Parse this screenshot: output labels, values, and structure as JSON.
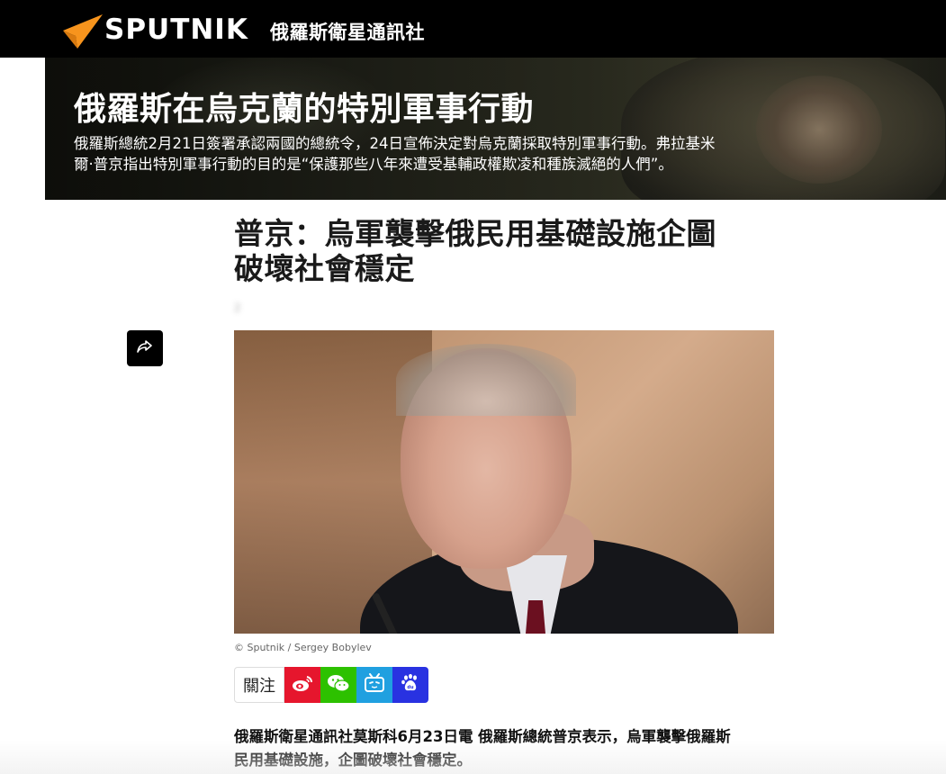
{
  "header": {
    "logo_text": "SPUTNIK",
    "logo_icon": "sputnik-wing-icon",
    "agency_name": "俄羅斯衛星通訊社",
    "background_color": "#000000",
    "accent_color": "#f7941d"
  },
  "hero": {
    "title": "俄羅斯在烏克蘭的特別軍事行動",
    "description_line1": "俄羅斯總統2月21日簽署承認兩國的總統令，24日宣佈決定對烏克蘭採取特別軍事行動。弗拉基米",
    "description_line2": "爾·普京指出特別軍事行動的目的是“保護那些八年來遭受基輔政權欺凌和種族滅絕的人們”。"
  },
  "article": {
    "headline_line1": "普京：烏軍襲擊俄民用基礎設施企圖",
    "headline_line2": "破壞社會穩定",
    "date": "2",
    "share_icon": "share-icon",
    "photo_credit": "© Sputnik / Sergey Bobylev",
    "follow_label": "關注",
    "social_icons": [
      "weibo-icon",
      "wechat-icon",
      "bilibili-icon",
      "baidu-icon"
    ],
    "lead_line1": "俄羅斯衛星通訊社莫斯科6月23日電 俄羅斯總統普京表示，烏軍襲擊俄羅斯",
    "lead_line2": "民用基礎設施，企圖破壞社會穩定。"
  }
}
